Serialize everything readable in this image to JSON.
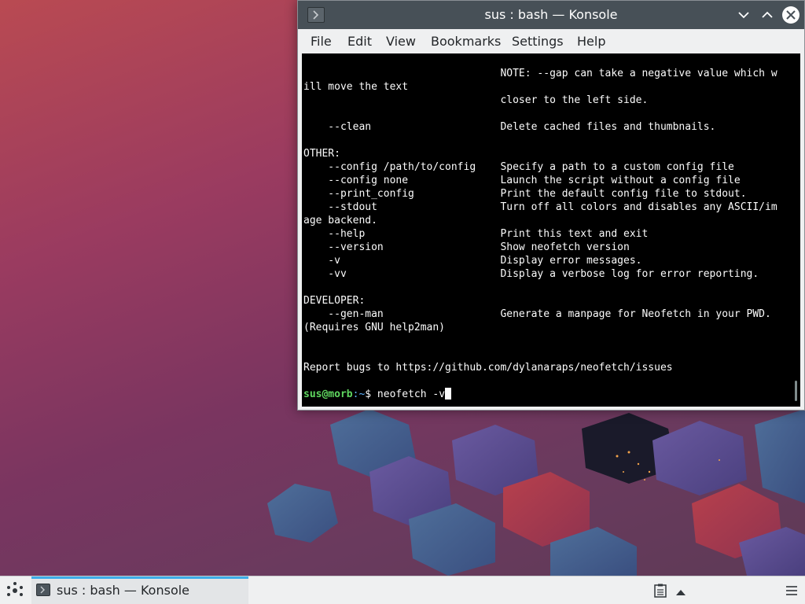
{
  "window": {
    "title": "sus : bash — Konsole",
    "menu": [
      "File",
      "Edit",
      "View",
      "Bookmarks",
      "Settings",
      "Help"
    ]
  },
  "terminal": {
    "lines": [
      "                                NOTE: --gap can take a negative value which w",
      "ill move the text",
      "                                closer to the left side.",
      "",
      "    --clean                     Delete cached files and thumbnails.",
      "",
      "OTHER:",
      "    --config /path/to/config    Specify a path to a custom config file",
      "    --config none               Launch the script without a config file",
      "    --print_config              Print the default config file to stdout.",
      "    --stdout                    Turn off all colors and disables any ASCII/im",
      "age backend.",
      "    --help                      Print this text and exit",
      "    --version                   Show neofetch version",
      "    -v                          Display error messages.",
      "    -vv                         Display a verbose log for error reporting.",
      "",
      "DEVELOPER:",
      "    --gen-man                   Generate a manpage for Neofetch in your PWD.",
      "(Requires GNU help2man)",
      "",
      "",
      "Report bugs to https://github.com/dylanaraps/neofetch/issues",
      ""
    ],
    "prompt": {
      "user_host": "sus@morb",
      "path": ":~",
      "symbol": "$",
      "command": " neofetch -v"
    }
  },
  "taskbar": {
    "task_label": "sus : bash — Konsole"
  },
  "colors": {
    "titlebar": "#475057",
    "terminal_bg": "#000000",
    "accent": "#3daee9",
    "prompt_user": "#5fd75f"
  }
}
